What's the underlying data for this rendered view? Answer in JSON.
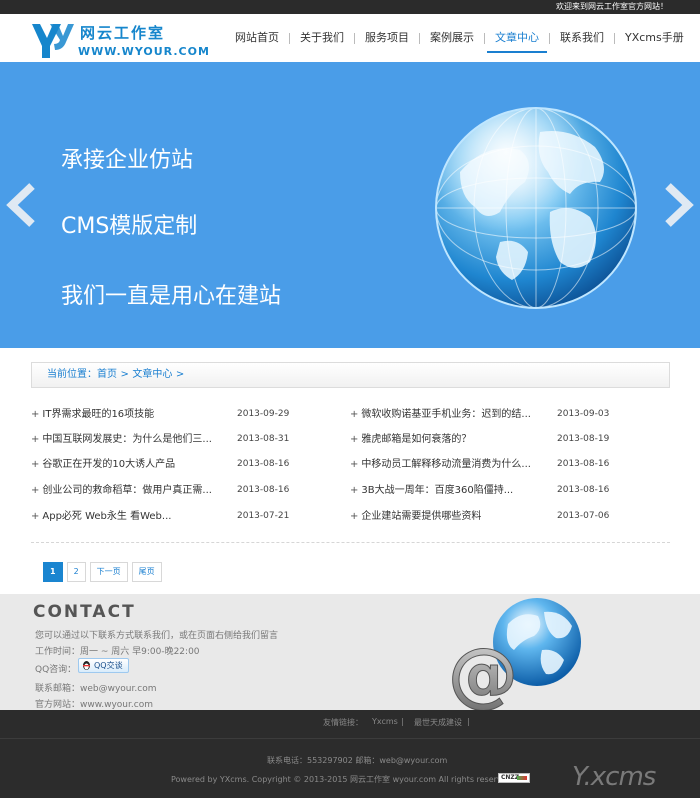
{
  "topbar": {
    "welcome": "欢迎来到网云工作室官方网站！"
  },
  "logo": {
    "cn": "网云工作室",
    "en": "WWW.WYOUR.COM"
  },
  "nav": {
    "items": [
      {
        "label": "网站首页"
      },
      {
        "label": "关于我们"
      },
      {
        "label": "服务项目"
      },
      {
        "label": "案例展示"
      },
      {
        "label": "文章中心"
      },
      {
        "label": "联系我们"
      },
      {
        "label": "YXcms手册"
      }
    ],
    "active": "文章中心"
  },
  "banner": {
    "lines": [
      "承接企业仿站",
      "CMS模版定制",
      "我们一直是用心在建站"
    ],
    "prev_icon": "chevron-left-icon",
    "next_icon": "chevron-right-icon",
    "image": "globe-icon",
    "bg_color": "#4a9de8"
  },
  "breadcrumb": {
    "lead": "当前位置：",
    "home": "首页",
    "sep": ">",
    "current": "文章中心"
  },
  "articles": {
    "left": [
      {
        "title": "IT界需求最旺的16项技能",
        "date": "2013-09-29"
      },
      {
        "title": "中国互联网发展史：为什么是他们三...",
        "date": "2013-08-31"
      },
      {
        "title": "谷歌正在开发的10大诱人产品",
        "date": "2013-08-16"
      },
      {
        "title": "创业公司的救命稻草：做用户真正需...",
        "date": "2013-08-16"
      },
      {
        "title": "App必死 Web永生 看Web...",
        "date": "2013-07-21"
      }
    ],
    "right": [
      {
        "title": "微软收购诺基亚手机业务：迟到的结...",
        "date": "2013-09-03"
      },
      {
        "title": "雅虎邮箱是如何衰落的？",
        "date": "2013-08-19"
      },
      {
        "title": "中移动员工解释移动流量消费为什么...",
        "date": "2013-08-16"
      },
      {
        "title": "3B大战一周年：百度360陷僵持...",
        "date": "2013-08-16"
      },
      {
        "title": "企业建站需要提供哪些资料",
        "date": "2013-07-06"
      }
    ],
    "bullet": "+"
  },
  "pagination": {
    "pages": [
      "1",
      "2"
    ],
    "current": "1",
    "next": "下一页",
    "last": "尾页"
  },
  "contact": {
    "heading": "CONTACT",
    "intro": "您可以通过以下联系方式联系我们，或在页面右侧给我们留言",
    "hours": "工作时间：周一 ~ 周六 早9:00-晚22:00",
    "qq_label": "QQ咨询：",
    "qq_button": "QQ交谈",
    "email": "联系邮箱：web@wyour.com",
    "website": "官方网站：www.wyour.com",
    "art": "at-sign-globe-icon"
  },
  "footer": {
    "links_label": "友情链接：",
    "links": [
      "Yxcms",
      "最世天成建设"
    ],
    "link_sep": "|",
    "contact_line": "联系电话：553297902  邮箱：web@wyour.com",
    "copyright": "Powered by YXcms. Copyright © 2013-2015 网云工作室 wyour.com All rights reserved.",
    "stats_badge": "CNZZ",
    "brand": "Y.xcms"
  },
  "colors": {
    "accent": "#1a7fd0",
    "banner": "#4a9de8",
    "footer": "#2c2c2c",
    "contact_bg": "#e9e9e9"
  }
}
